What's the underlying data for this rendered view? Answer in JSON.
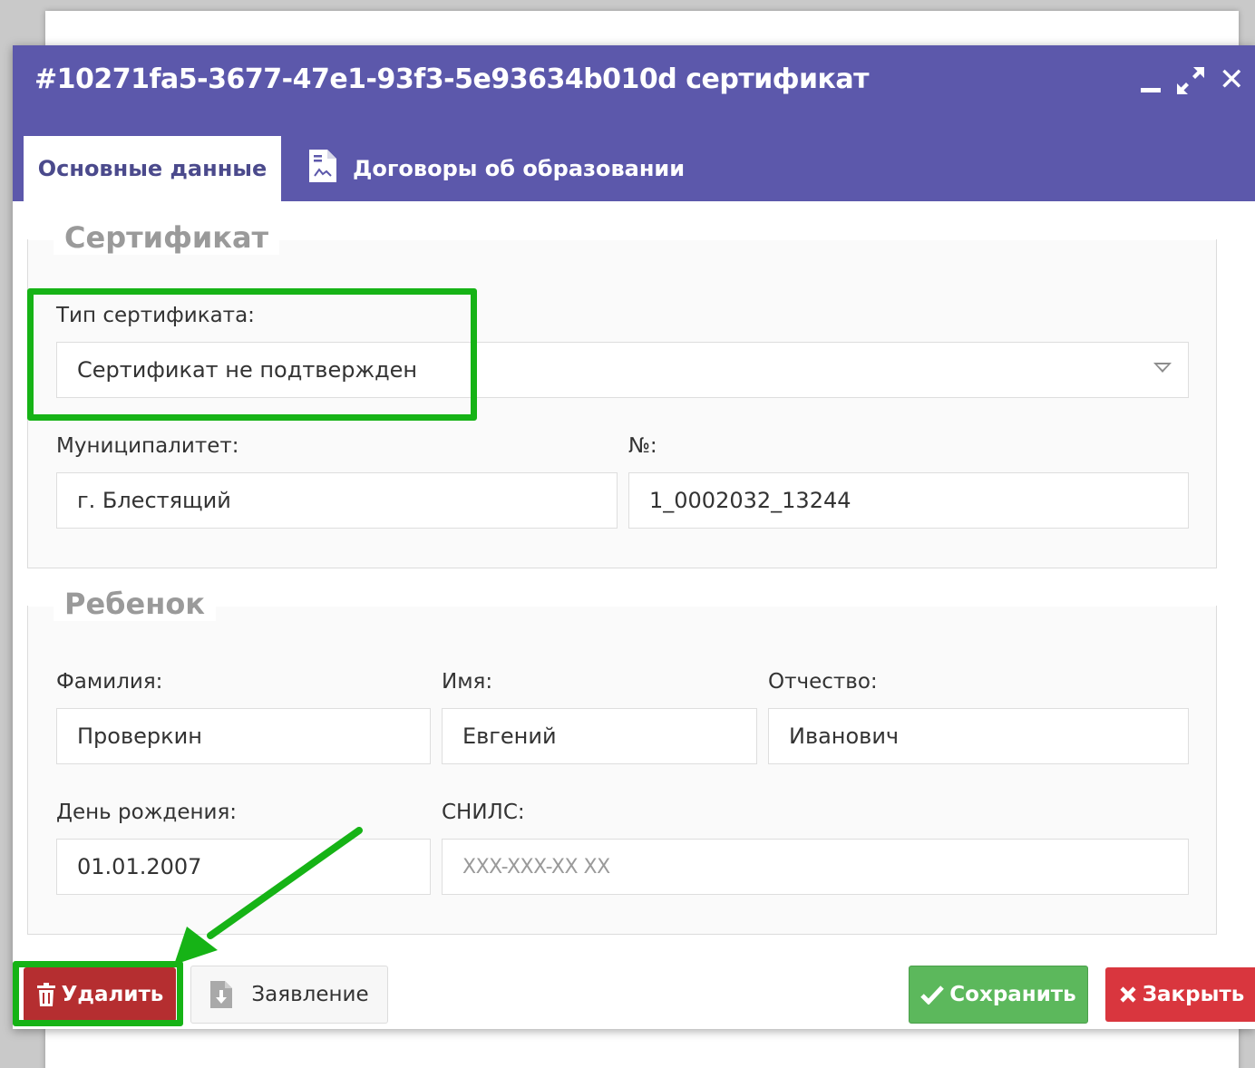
{
  "window": {
    "title": "#10271fa5-3677-47e1-93f3-5e93634b010d сертификат",
    "minimize_icon": "minimize-icon",
    "maximize_icon": "expand-icon",
    "close_icon": "close-icon"
  },
  "tabs": [
    {
      "label": "Основные данные",
      "active": true
    },
    {
      "label": "Договоры об образовании",
      "active": false,
      "icon": "document-icon"
    }
  ],
  "certificate": {
    "legend": "Сертификат",
    "type_label": "Тип сертификата:",
    "type_value": "Сертификат не подтвержден",
    "municipality_label": "Муниципалитет:",
    "municipality_value": "г. Блестящий",
    "number_label": "№:",
    "number_value": "1_0002032_13244"
  },
  "child": {
    "legend": "Ребенок",
    "surname_label": "Фамилия:",
    "surname_value": "Проверкин",
    "name_label": "Имя:",
    "name_value": "Евгений",
    "patronymic_label": "Отчество:",
    "patronymic_value": "Иванович",
    "birthday_label": "День рождения:",
    "birthday_value": "01.01.2007",
    "snils_label": "СНИЛС:",
    "snils_placeholder": "XXX-XXX-XX XX"
  },
  "footer": {
    "delete_label": "Удалить",
    "application_label": "Заявление",
    "save_label": "Сохранить",
    "close_label": "Закрыть"
  },
  "colors": {
    "titlebar": "#5c58ab",
    "highlight": "#16b316",
    "delete": "#b52e30",
    "save": "#5cb85c",
    "close": "#d9363e"
  }
}
